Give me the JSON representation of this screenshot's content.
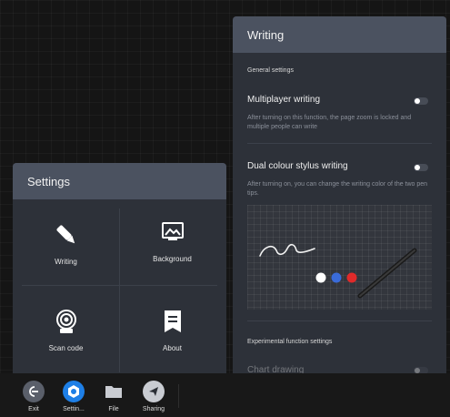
{
  "writing_panel": {
    "title": "Writing",
    "general_section": "General settings",
    "multiplayer": {
      "title": "Multiplayer writing",
      "description": "After turning on this function, the page zoom is locked and multiple people can write",
      "enabled": false
    },
    "dual_colour": {
      "title": "Dual colour stylus writing",
      "description": "After turning on, you can change the writing color of the two pen tips.",
      "enabled": false
    },
    "pen_colors": [
      "#ffffff",
      "#3a6bd8",
      "#e02a2a"
    ],
    "experimental_section": "Experimental function settings",
    "chart_drawing": {
      "title": "Chart drawing",
      "enabled": false
    }
  },
  "settings_panel": {
    "title": "Settings",
    "tiles": [
      {
        "label": "Writing",
        "icon": "pen-icon"
      },
      {
        "label": "Background",
        "icon": "image-icon"
      },
      {
        "label": "Scan code",
        "icon": "scan-code-icon"
      },
      {
        "label": "About",
        "icon": "about-icon"
      }
    ]
  },
  "taskbar": {
    "items": [
      {
        "label": "Exit",
        "icon": "exit-icon",
        "color": "#5a5f6a"
      },
      {
        "label": "Settin...",
        "icon": "settings-gear-icon",
        "color": "#1e7fe6"
      },
      {
        "label": "File",
        "icon": "folder-icon",
        "color": "#5a5f6a"
      },
      {
        "label": "Sharing",
        "icon": "share-icon",
        "color": "#5a5f6a"
      }
    ]
  }
}
